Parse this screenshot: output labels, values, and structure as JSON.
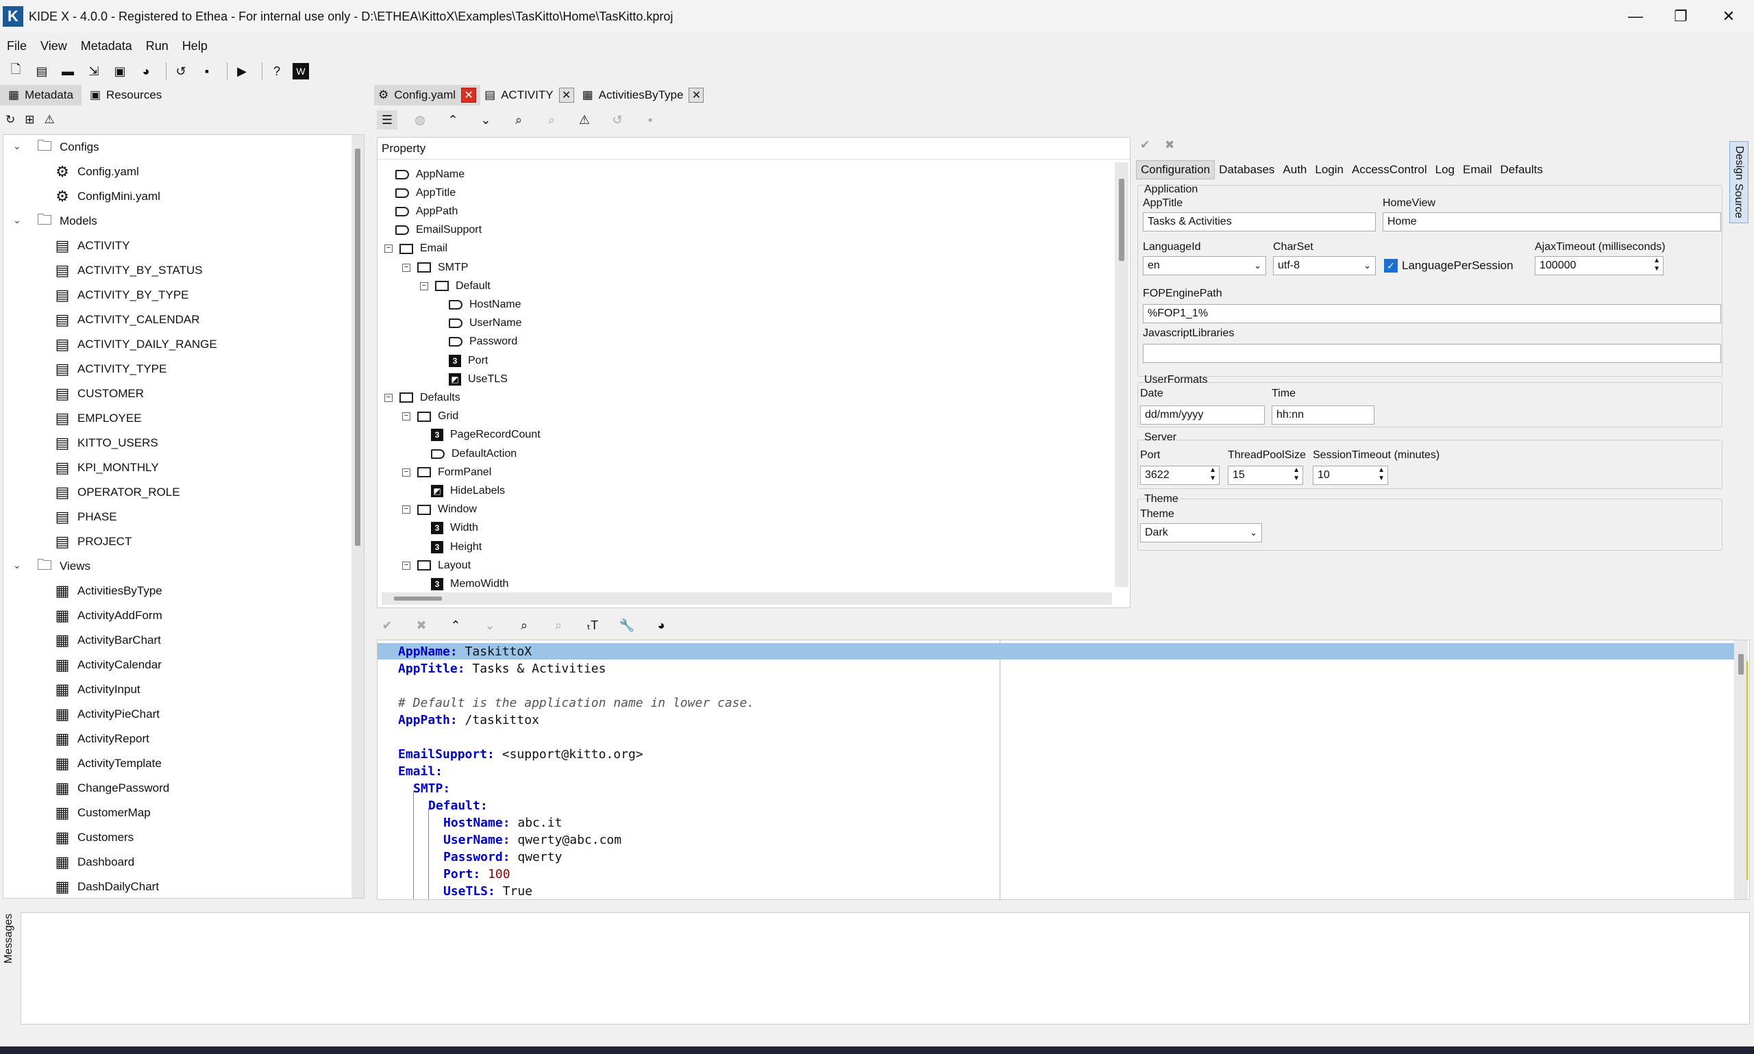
{
  "window": {
    "logo": "K",
    "title": "KIDE X - 4.0.0 - Registered to Ethea - For internal use only - D:\\ETHEA\\KittoX\\Examples\\TasKitto\\Home\\TasKitto.kproj",
    "minimize": "—",
    "maximize": "❐",
    "close": "✕"
  },
  "menu": [
    "File",
    "View",
    "Metadata",
    "Run",
    "Help"
  ],
  "toolbar": {
    "icons": [
      "new-file-icon",
      "new-project-icon",
      "open-folder-icon",
      "import-icon",
      "save-all-icon",
      "palette-icon",
      "history-icon",
      "save-icon",
      "run-icon",
      "help-icon",
      "wiki-icon"
    ]
  },
  "left_tabs": {
    "metadata": "Metadata",
    "resources": "Resources"
  },
  "tree": {
    "configs": "Configs",
    "config_items": [
      "Config.yaml",
      "ConfigMini.yaml"
    ],
    "models": "Models",
    "model_items": [
      "ACTIVITY",
      "ACTIVITY_BY_STATUS",
      "ACTIVITY_BY_TYPE",
      "ACTIVITY_CALENDAR",
      "ACTIVITY_DAILY_RANGE",
      "ACTIVITY_TYPE",
      "CUSTOMER",
      "EMPLOYEE",
      "KITTO_USERS",
      "KPI_MONTHLY",
      "OPERATOR_ROLE",
      "PHASE",
      "PROJECT"
    ],
    "views": "Views",
    "view_items": [
      "ActivitiesByType",
      "ActivityAddForm",
      "ActivityBarChart",
      "ActivityCalendar",
      "ActivityInput",
      "ActivityPieChart",
      "ActivityReport",
      "ActivityTemplate",
      "ChangePassword",
      "CustomerMap",
      "Customers",
      "Dashboard",
      "DashDailyChart"
    ]
  },
  "doc_tabs": [
    "Config.yaml",
    "ACTIVITY",
    "ActivitiesByType"
  ],
  "property_grid": {
    "header": "Property",
    "nodes": [
      "AppName",
      "AppTitle",
      "AppPath",
      "EmailSupport",
      "Email",
      "SMTP",
      "Default",
      "HostName",
      "UserName",
      "Password",
      "Port",
      "UseTLS",
      "Defaults",
      "Grid",
      "PageRecordCount",
      "DefaultAction",
      "FormPanel",
      "HideLabels",
      "Window",
      "Width",
      "Height",
      "Layout",
      "MemoWidth"
    ]
  },
  "design": {
    "tabs": [
      "Configuration",
      "Databases",
      "Auth",
      "Login",
      "AccessControl",
      "Log",
      "Email",
      "Defaults"
    ],
    "application": {
      "group": "Application",
      "apptitle_label": "AppTitle",
      "apptitle": "Tasks & Activities",
      "homeview_label": "HomeView",
      "homeview": "Home",
      "languageid_label": "LanguageId",
      "languageid": "en",
      "charset_label": "CharSet",
      "charset": "utf-8",
      "langpersession": "LanguagePerSession",
      "ajax_label": "AjaxTimeout (milliseconds)",
      "ajax": "100000",
      "fop_label": "FOPEnginePath",
      "fop": "%FOP1_1%",
      "js_label": "JavascriptLibraries",
      "js": ""
    },
    "userformats": {
      "group": "UserFormats",
      "date_label": "Date",
      "date": "dd/mm/yyyy",
      "time_label": "Time",
      "time": "hh:nn"
    },
    "server": {
      "group": "Server",
      "port_label": "Port",
      "port": "3622",
      "threads_label": "ThreadPoolSize",
      "threads": "15",
      "session_label": "SessionTimeout (minutes)",
      "session": "10"
    },
    "theme": {
      "group": "Theme",
      "label": "Theme",
      "value": "Dark"
    },
    "side_design": "Design",
    "side_source": "Source"
  },
  "code": {
    "l1k": "AppName:",
    "l1v": " TaskittoX",
    "l2k": "AppTitle:",
    "l2v": " Tasks & Activities",
    "l4c": "# Default is the application name in lower case.",
    "l5k": "AppPath:",
    "l5v": " /taskittox",
    "l7k": "EmailSupport:",
    "l7v": " <support@kitto.org>",
    "l8k": "Email:",
    "l9k": "SMTP:",
    "l10k": "Default:",
    "l11k": "HostName:",
    "l11v": " abc.it",
    "l12k": "UserName:",
    "l12v": " qwerty@abc.com",
    "l13k": "Password:",
    "l13v": " qwerty",
    "l14k": "Port:",
    "l14v": " 100",
    "l15k": "UseTLS:",
    "l15v": " True"
  },
  "messages": "Messages"
}
